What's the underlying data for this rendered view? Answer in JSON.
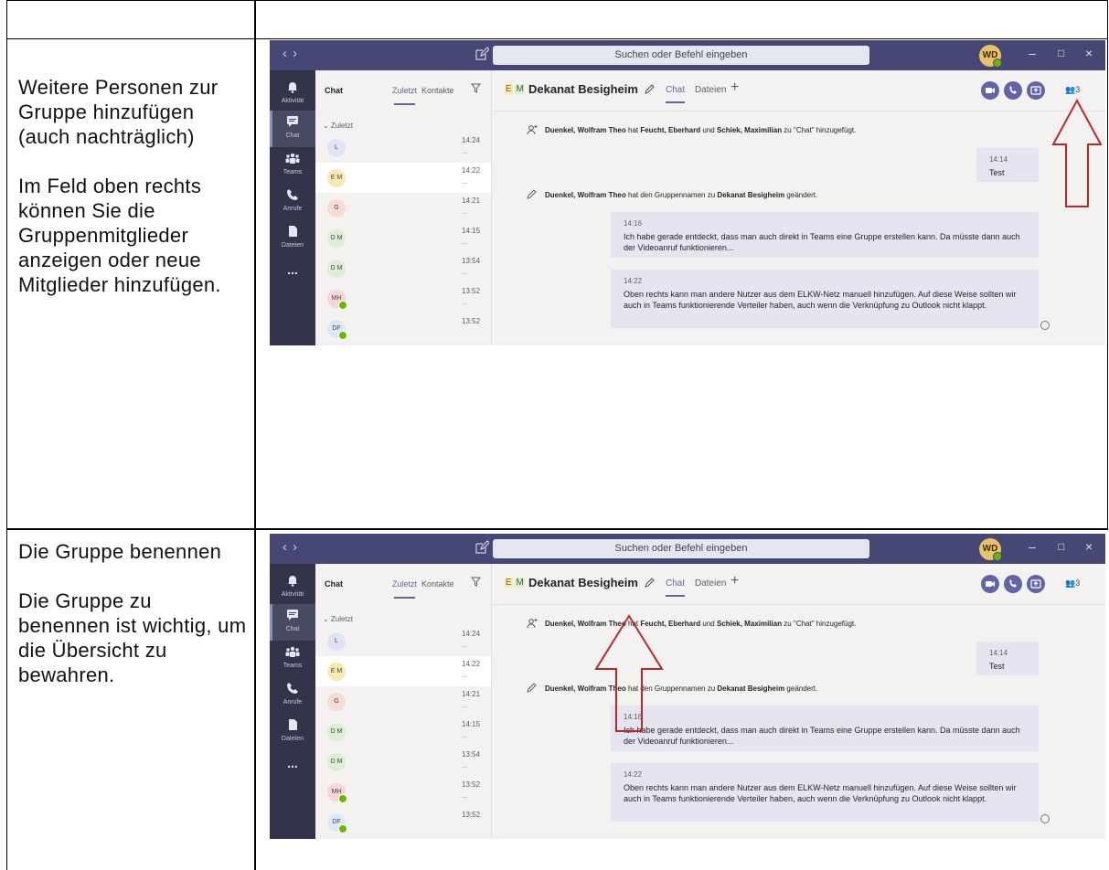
{
  "rows": [
    {
      "heading": "Weitere Personen zur Gruppe hinzufügen (auch nachträglich)",
      "description": "Im Feld oben rechts können Sie die Gruppenmitglieder anzeigen oder neue Mitglieder hinzufügen."
    },
    {
      "heading": "Die Gruppe benennen",
      "description": "Die Gruppe zu benennen ist wichtig, um die Übersicht zu bewahren."
    }
  ],
  "teams": {
    "search_placeholder": "Suchen oder Befehl eingeben",
    "user_initials": "WD",
    "rail": [
      {
        "label": "Aktivität",
        "icon": "bell-icon"
      },
      {
        "label": "Chat",
        "icon": "chat-icon"
      },
      {
        "label": "Teams",
        "icon": "teams-icon"
      },
      {
        "label": "Anrufe",
        "icon": "phone-icon"
      },
      {
        "label": "Dateien",
        "icon": "file-icon"
      },
      {
        "label": "...",
        "icon": "more-icon"
      }
    ],
    "list_header": "Chat",
    "tab_recent": "Zuletzt",
    "tab_contacts": "Kontakte",
    "section_label": "Zuletzt",
    "chats": [
      {
        "initials": "L",
        "time": "14:24",
        "color": "#dfe4f5"
      },
      {
        "initials": "E M",
        "time": "14:22",
        "color": "#f6e9b3"
      },
      {
        "initials": "G",
        "time": "14:21",
        "color": "#f7dcd6"
      },
      {
        "initials": "D M",
        "time": "14:15",
        "color": "#dceed3"
      },
      {
        "initials": "D M",
        "time": "13:54",
        "color": "#dceed3"
      },
      {
        "initials": "MH",
        "time": "13:52",
        "color": "#f7d5d9"
      },
      {
        "initials": "DF",
        "time": "13:52",
        "color": "#dbe8f5"
      }
    ],
    "group_initials_e": "E",
    "group_initials_m": "M",
    "group_name": "Dekanat Besigheim",
    "tab_chat": "Chat",
    "tab_files": "Dateien",
    "people_count": "3",
    "sys1_pre": "Duenkel, Wolfram Theo",
    "sys1_mid1": " hat ",
    "sys1_name2": "Feucht, Eberhard",
    "sys1_mid2": " und ",
    "sys1_name3": "Schiek, Maximilian",
    "sys1_post": " zu \"Chat\" hinzugefügt.",
    "own_msg_time": "14:14",
    "own_msg_text": "Test",
    "sys2_pre": "Duenkel, Wolfram Theo",
    "sys2_mid": " hat den Gruppennamen zu ",
    "sys2_name": "Dekanat Besigheim",
    "sys2_post": " geändert.",
    "msg1_time": "14:16",
    "msg1_text": "Ich habe gerade entdeckt, dass man auch direkt in Teams eine Gruppe erstellen kann. Da müsste dann auch der Videoanruf funktionieren...",
    "msg2_time": "14:22",
    "msg2_text": "Oben rechts kann man andere Nutzer aus dem ELKW-Netz manuell hinzufügen. Auf diese Weise sollten wir auch in Teams funktionierende Verteiler haben, auch wenn die Verknüpfung zu Outlook nicht klappt.",
    "accent": "#6264a7",
    "titlebar": "#464775",
    "arrow_color": "#c0262d"
  }
}
